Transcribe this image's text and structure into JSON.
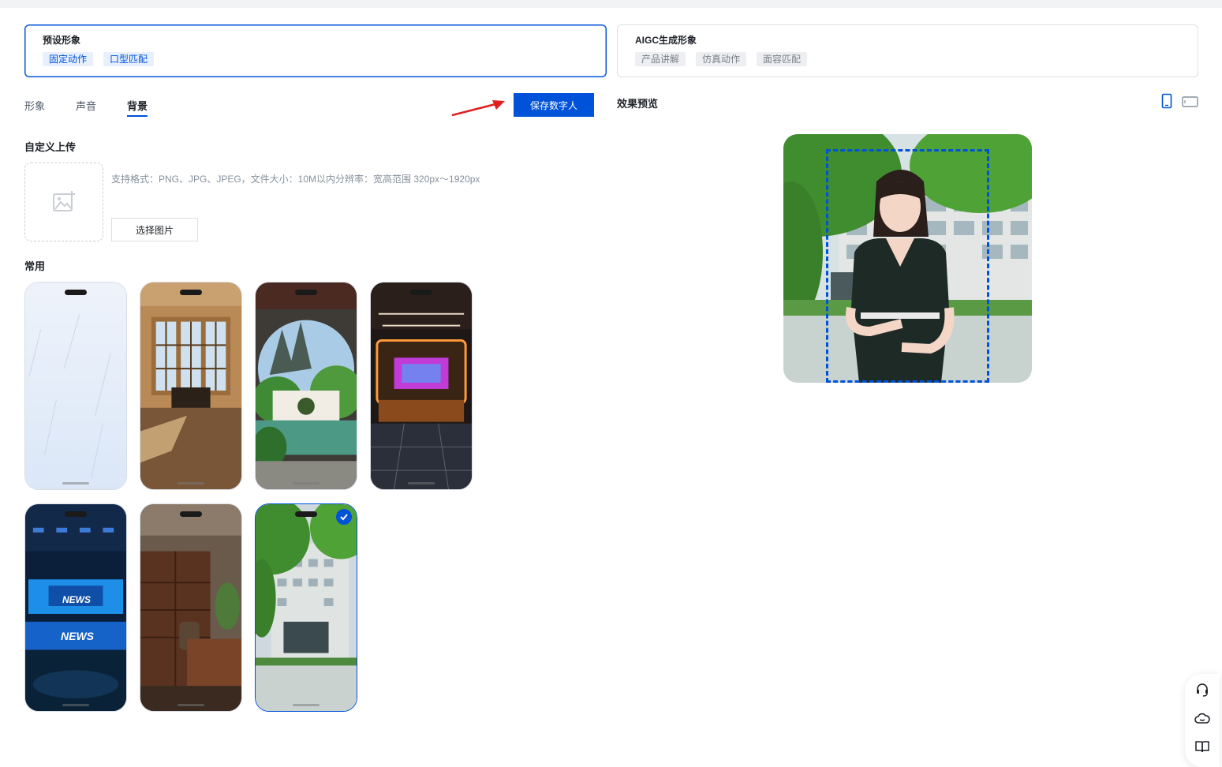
{
  "modes": [
    {
      "title": "预设形象",
      "tags": [
        "固定动作",
        "口型匹配"
      ],
      "active": true
    },
    {
      "title": "AIGC生成形象",
      "tags": [
        "产品讲解",
        "仿真动作",
        "面容匹配"
      ],
      "active": false
    }
  ],
  "tabs": [
    {
      "label": "形象",
      "active": false
    },
    {
      "label": "声音",
      "active": false
    },
    {
      "label": "背景",
      "active": true
    }
  ],
  "save_button": "保存数字人",
  "custom_upload": {
    "title": "自定义上传",
    "hint": "支持格式：PNG、JPG、JPEG，文件大小：10M以内分辨率：宽高范围 320px～1920px",
    "choose_button": "选择图片"
  },
  "common": {
    "title": "常用",
    "backgrounds": [
      {
        "name": "light-blue-texture",
        "selected": false
      },
      {
        "name": "classic-room",
        "selected": false
      },
      {
        "name": "chinese-garden",
        "selected": false
      },
      {
        "name": "neon-stage",
        "selected": false
      },
      {
        "name": "news-studio",
        "selected": false
      },
      {
        "name": "wooden-office",
        "selected": false
      },
      {
        "name": "campus-building",
        "selected": true
      }
    ],
    "news_text": "NEWS"
  },
  "preview": {
    "title": "效果预览",
    "orientation": "portrait"
  },
  "colors": {
    "primary": "#0052d9",
    "arrow": "#e02020"
  },
  "float_tools": [
    "headset-icon",
    "cloud-icon",
    "book-icon"
  ]
}
